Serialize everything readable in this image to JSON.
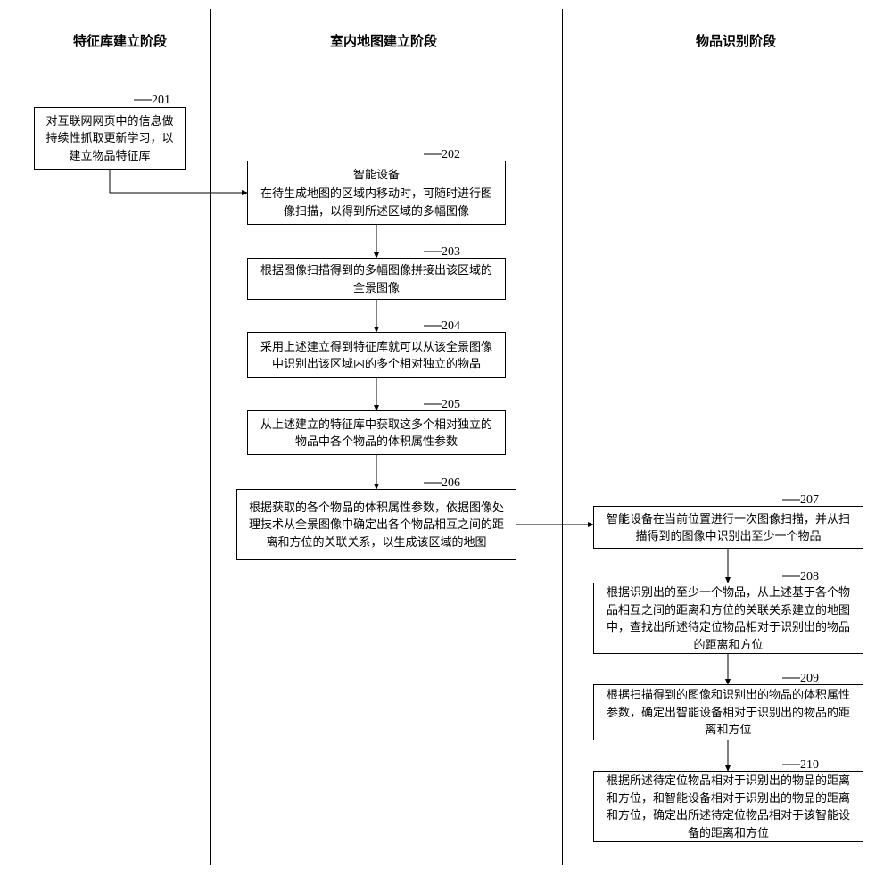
{
  "headers": {
    "col1": "特征库建立阶段",
    "col2": "室内地图建立阶段",
    "col3": "物品识别阶段"
  },
  "boxes": {
    "b201": {
      "label": "201",
      "text": "对互联网网页中的信息做持续性抓取更新学习，以建立物品特征库"
    },
    "b202": {
      "label": "202",
      "title": "智能设备",
      "text": "在待生成地图的区域内移动时，可随时进行图像扫描，以得到所述区域的多幅图像"
    },
    "b203": {
      "label": "203",
      "text": "根据图像扫描得到的多幅图像拼接出该区域的全景图像"
    },
    "b204": {
      "label": "204",
      "text": "采用上述建立得到特征库就可以从该全景图像中识别出该区域内的多个相对独立的物品"
    },
    "b205": {
      "label": "205",
      "text": "从上述建立的特征库中获取这多个相对独立的物品中各个物品的体积属性参数"
    },
    "b206": {
      "label": "206",
      "text": "根据获取的各个物品的体积属性参数，依据图像处理技术从全景图像中确定出各个物品相互之间的距离和方位的关联关系，以生成该区域的地图"
    },
    "b207": {
      "label": "207",
      "text": "智能设备在当前位置进行一次图像扫描，并从扫描得到的图像中识别出至少一个物品"
    },
    "b208": {
      "label": "208",
      "text": "根据识别出的至少一个物品，从上述基于各个物品相互之间的距离和方位的关联关系建立的地图中，查找出所述待定位物品相对于识别出的物品的距离和方位"
    },
    "b209": {
      "label": "209",
      "text": "根据扫描得到的图像和识别出的物品的体积属性参数，确定出智能设备相对于识别出的物品的距离和方位"
    },
    "b210": {
      "label": "210",
      "text": "根据所述待定位物品相对于识别出的物品的距离和方位，和智能设备相对于识别出的物品的距离和方位，确定出所述待定位物品相对于该智能设备的距离和方位"
    }
  }
}
